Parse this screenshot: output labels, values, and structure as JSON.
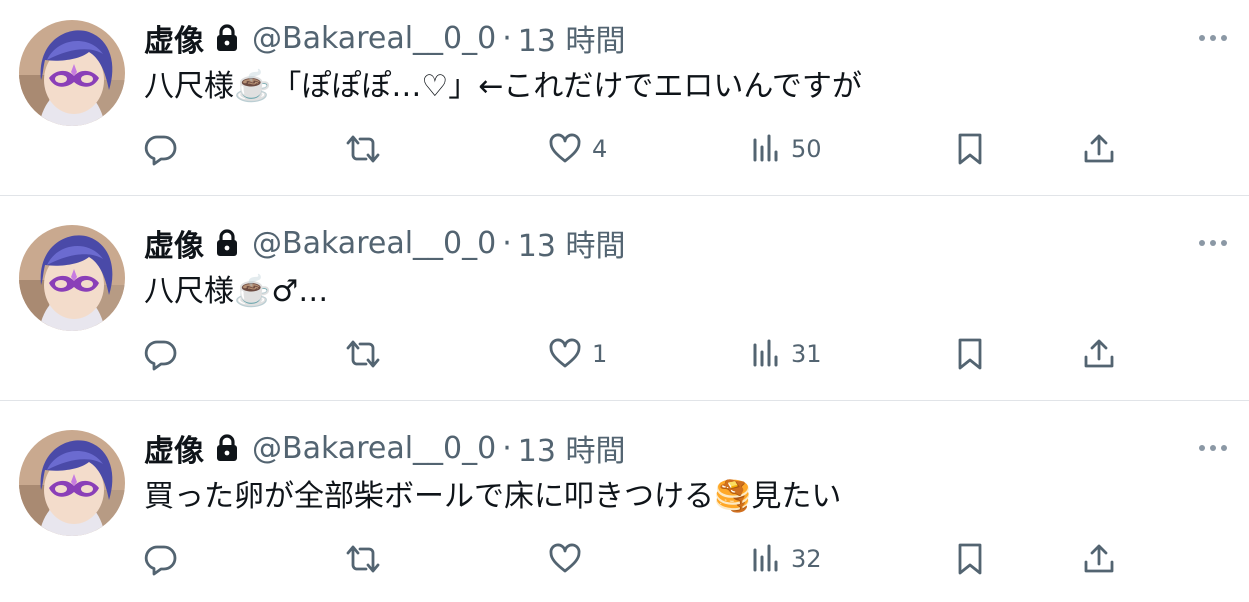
{
  "tweets": [
    {
      "display_name": "虚像",
      "handle": "@Bakareal__0_0",
      "separator": "·",
      "time": "13 時間",
      "text": "八尺様☕️「ぽぽぽ…♡」←これだけでエロいんですが",
      "like_count": "4",
      "view_count": "50"
    },
    {
      "display_name": "虚像",
      "handle": "@Bakareal__0_0",
      "separator": "·",
      "time": "13 時間",
      "text": "八尺様☕️♂…",
      "like_count": "1",
      "view_count": "31"
    },
    {
      "display_name": "虚像",
      "handle": "@Bakareal__0_0",
      "separator": "·",
      "time": "13 時間",
      "text": "買った卵が全部柴ボールで床に叩きつける🥞見たい",
      "like_count": "",
      "view_count": "32"
    }
  ],
  "icons": {
    "avatar": "avatar-image",
    "lock": "lock-icon",
    "more": "more-dots-icon",
    "reply": "reply-icon",
    "retweet": "retweet-icon",
    "like": "heart-icon",
    "views": "views-icon",
    "bookmark": "bookmark-icon",
    "share": "share-icon"
  },
  "colors": {
    "text_primary": "#0f1419",
    "text_secondary": "#536471",
    "divider": "#e1e4e8"
  }
}
